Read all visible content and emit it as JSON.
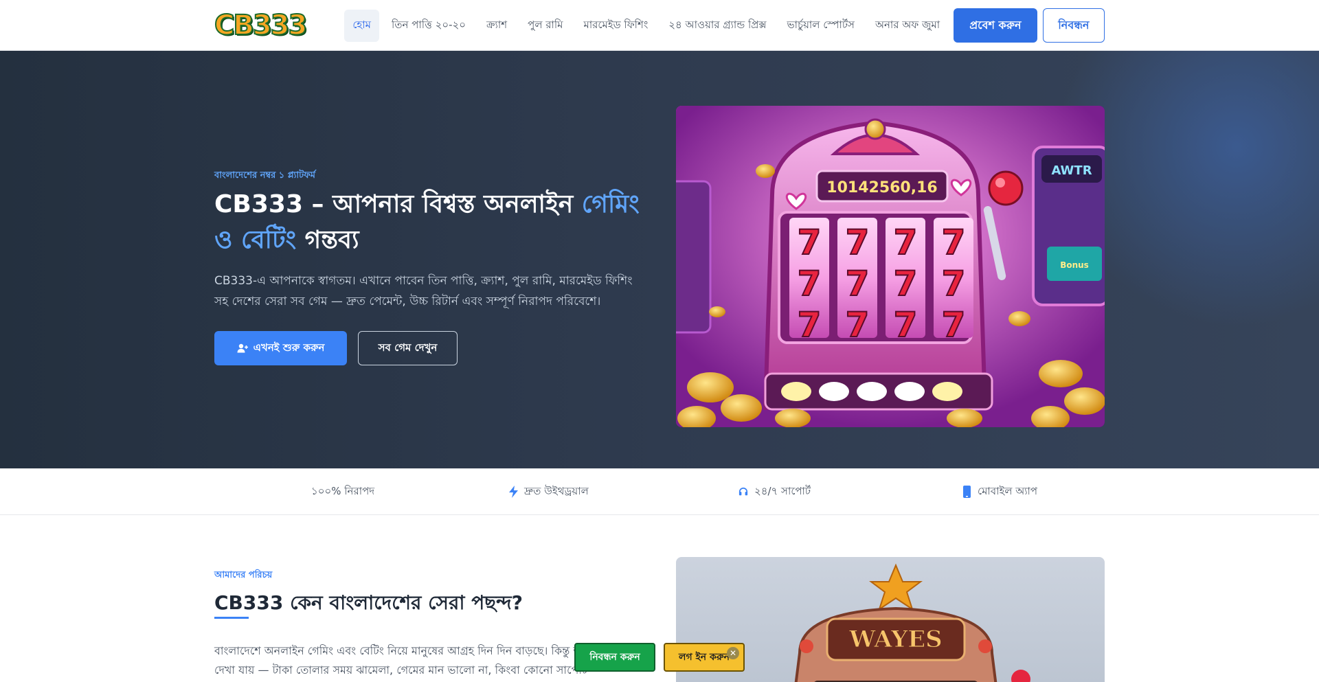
{
  "nav": {
    "logo_text": "CB333",
    "links": [
      "হোম",
      "তিন পাত্তি ২০-২০",
      "ক্র্যাশ",
      "পুল রামি",
      "মারমেইড ফিশিং",
      "২৪ আওয়ার গ্র্যান্ড প্রিক্স",
      "ভার্চুয়াল স্পোর্টস",
      "অনার অফ জুমা"
    ],
    "login_label": "প্রবেশ করুন",
    "register_label": "নিবন্ধন"
  },
  "hero": {
    "eyebrow": "বাংলাদেশের নম্বর ১ প্ল্যাটফর্ম",
    "title_part1": "CB333 – আপনার বিশ্বস্ত অনলাইন ",
    "title_highlight": "গেমিং ও বেটিং",
    "title_part2": " গন্তব্য",
    "description": "CB333-এ আপনাকে স্বাগতম। এখানে পাবেন তিন পাত্তি, ক্র্যাশ, পুল রামি, মারমেইড ফিশিং সহ দেশের সেরা সব গেম — দ্রুত পেমেন্ট, উচ্চ রিটার্ন এবং সম্পূর্ণ নিরাপদ পরিবেশে।",
    "cta_primary": "এখনই শুরু করুন",
    "cta_secondary": "সব গেম দেখুন",
    "image": {
      "jackpot_text": "10142560,16",
      "side_sign_text": "AWTR",
      "screen_text": "Bonus",
      "reel_symbol": "7"
    }
  },
  "features": [
    {
      "icon": "shield-icon",
      "label": "১০০% নিরাপদ"
    },
    {
      "icon": "lightning-icon",
      "label": "দ্রুত উইথড্রয়াল"
    },
    {
      "icon": "headset-icon",
      "label": "২৪/৭ সাপোর্ট"
    },
    {
      "icon": "mobile-icon",
      "label": "মোবাইল অ্যাপ"
    }
  ],
  "about": {
    "eyebrow": "আমাদের পরিচয়",
    "title": "CB333 কেন বাংলাদেশের সেরা পছন্দ?",
    "text": "বাংলাদেশে অনলাইন গেমিং এবং বেটিং নিয়ে মানুষের আগ্রহ দিন দিন বাড়ছে। কিন্তু অনেক প্ল্যাটফর্মেই দেখা যায় — টাকা তোলার সময় ঝামেলা, গেমের মান ভালো না, কিংবা কোনো সাপোর্ট",
    "image": {
      "sign_text": "WAYES"
    }
  },
  "floating": {
    "register_label": "নিবন্ধন করুন",
    "login_label": "লগ ইন করুন",
    "close_glyph": "✕"
  },
  "colors": {
    "accent": "#2f6fe4",
    "hero_bg": "#2c3748",
    "float_register": "#16a34a",
    "float_login": "#f5c02e"
  }
}
